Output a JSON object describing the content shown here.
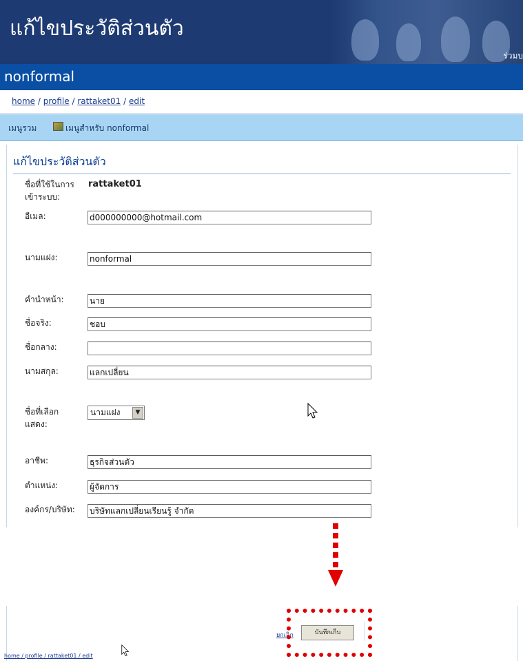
{
  "banner": {
    "title": "แก้ไขประวัติส่วนตัว",
    "tagline": "ร่วมบ"
  },
  "site": {
    "name": "nonformal"
  },
  "breadcrumb": {
    "home": "home",
    "profile": "profile",
    "user": "rattaket01",
    "edit": "edit",
    "separator": "/"
  },
  "menubar": {
    "main": "เมนูรวม",
    "user_menu": "เมนูสำหรับ nonformal"
  },
  "form": {
    "heading": "แก้ไขประวัติส่วนตัว",
    "username_label_1": "ชื่อที่ใช้ในการ",
    "username_label_2": "เข้าระบบ:",
    "username_value": "rattaket01",
    "email_label": "อีเมล:",
    "email_value": "d000000000@hotmail.com",
    "alias_label": "นามแฝง:",
    "alias_value": "nonformal",
    "prefix_label": "คำนำหน้า:",
    "prefix_value": "นาย",
    "firstname_label": "ชื่อจริง:",
    "firstname_value": "ชอบ",
    "middlename_label": "ชื่อกลาง:",
    "middlename_value": "",
    "lastname_label": "นามสกุล:",
    "lastname_value": "แลกเปลี่ยน",
    "display_label_1": "ชื่อที่เลือก",
    "display_label_2": "แสดง:",
    "display_value": "นามแฝง",
    "occupation_label": "อาชีพ:",
    "occupation_value": "ธุรกิจส่วนตัว",
    "position_label": "ตำแหน่ง:",
    "position_value": "ผู้จัดการ",
    "organization_label": "องค์กร/บริษัท:",
    "organization_value": "บริษัทแลกเปลี่ยนเรียนรู้ จำกัด"
  },
  "bottom": {
    "breadcrumb": "home / profile / rattaket01 / edit",
    "link": "ยกเลิก",
    "save_button": "บันทึกเก็บ"
  },
  "colors": {
    "banner_bg": "#1d3a72",
    "siteline_bg": "#0a4fa3",
    "menubar_bg": "#a9d5f5",
    "highlight": "#e00000"
  },
  "icons": [
    "menu-folder-icon",
    "mouse-cursor-icon",
    "arrow-down-icon"
  ]
}
